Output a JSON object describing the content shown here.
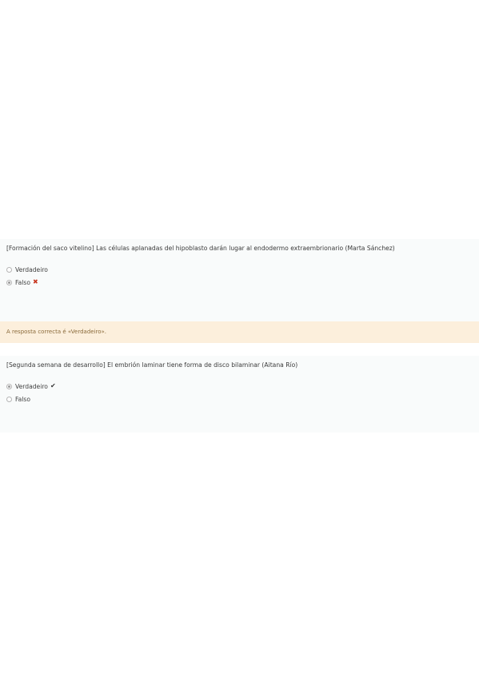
{
  "question1": {
    "text": "[Formación del saco vitelino] Las células aplanadas del hipoblasto darán lugar al endodermo extraembrionario (Marta Sánchez)",
    "options": [
      {
        "label": "Verdadeiro",
        "selected": false,
        "mark": ""
      },
      {
        "label": "Falso",
        "selected": true,
        "mark": "✖"
      }
    ]
  },
  "feedback": {
    "text": "A resposta correcta é «Verdadeiro»."
  },
  "question2": {
    "text": "[Segunda semana de desarrollo] El embrión laminar tiene forma de disco bilaminar (Aitana Río)",
    "options": [
      {
        "label": "Verdadeiro",
        "selected": true,
        "mark": "✔"
      },
      {
        "label": "Falso",
        "selected": false,
        "mark": ""
      }
    ]
  },
  "colors": {
    "question_bg": "#f9fbfb",
    "feedback_bg": "#fcefdc",
    "wrong_mark": "#c7361f",
    "right_mark": "#333333"
  }
}
